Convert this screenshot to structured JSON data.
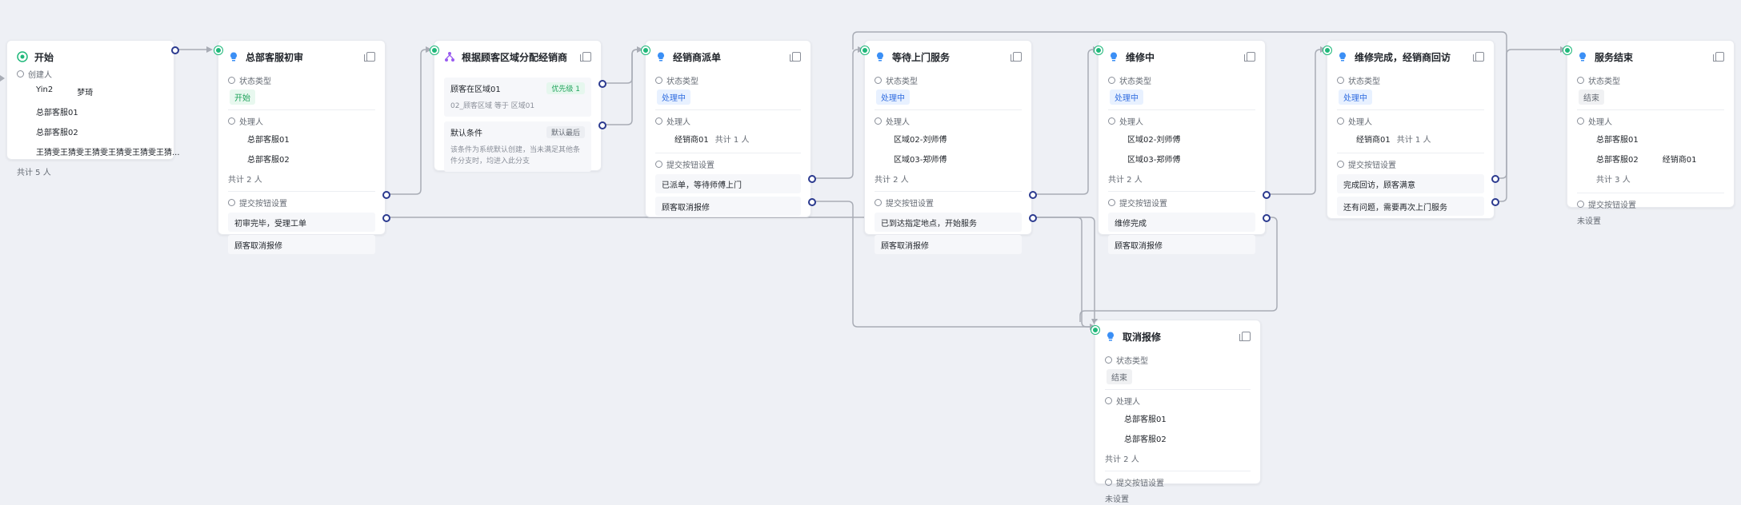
{
  "labels": {
    "status_type": "状态类型",
    "handler": "处理人",
    "creator": "创建人",
    "submit_settings": "提交按钮设置",
    "unset": "未设置"
  },
  "nodes": {
    "start": {
      "title": "开始",
      "creators": [
        "Yin2",
        "梦琦",
        "总部客服01",
        "总部客服02",
        "王猜雯王猜雯王猜雯王猜雯王猜雯王猜..."
      ],
      "total": "共计 5 人"
    },
    "hq_review": {
      "title": "总部客服初审",
      "status": "开始",
      "handlers": [
        "总部客服01",
        "总部客服02"
      ],
      "total": "共计 2 人",
      "buttons": [
        "初审完毕，受理工单",
        "顾客取消报修"
      ]
    },
    "route": {
      "title": "根据顾客区域分配经销商",
      "cond1_title": "顾客在区域01",
      "cond1_badge": "优先级 1",
      "cond1_desc": "02_顾客区域 等于 区域01",
      "cond2_title": "默认条件",
      "cond2_badge": "默认最后",
      "cond2_desc": "该条件为系统默认创建，当未满足其他条件分支时，均进入此分支"
    },
    "dealer_dispatch": {
      "title": "经销商派单",
      "status": "处理中",
      "handler": "经销商01",
      "total": "共计 1 人",
      "buttons": [
        "已派单，等待师傅上门",
        "顾客取消报修"
      ]
    },
    "wait_service": {
      "title": "等待上门服务",
      "status": "处理中",
      "handlers": [
        "区域02-刘师傅",
        "区域03-郑师傅"
      ],
      "total": "共计 2 人",
      "buttons": [
        "已到达指定地点，开始服务",
        "顾客取消报修"
      ]
    },
    "repairing": {
      "title": "维修中",
      "status": "处理中",
      "handlers": [
        "区域02-刘师傅",
        "区域03-郑师傅"
      ],
      "total": "共计 2 人",
      "buttons": [
        "维修完成",
        "顾客取消报修"
      ]
    },
    "revisit": {
      "title": "维修完成，经销商回访",
      "status": "处理中",
      "handler": "经销商01",
      "total": "共计 1 人",
      "buttons": [
        "完成回访，顾客满意",
        "还有问题，需要再次上门服务"
      ]
    },
    "service_end": {
      "title": "服务结束",
      "status": "结束",
      "handlers": [
        "总部客服01",
        "总部客服02"
      ],
      "handler3": "经销商01",
      "total": "共计 3 人"
    },
    "cancel": {
      "title": "取消报修",
      "status": "结束",
      "handlers": [
        "总部客服01",
        "总部客服02"
      ],
      "total": "共计 2 人"
    }
  },
  "colors": {
    "accent_green": "#1fb87a",
    "connector": "#2b3a8f",
    "wire": "#a0a4ad",
    "bulb": "#3b8ff5"
  }
}
